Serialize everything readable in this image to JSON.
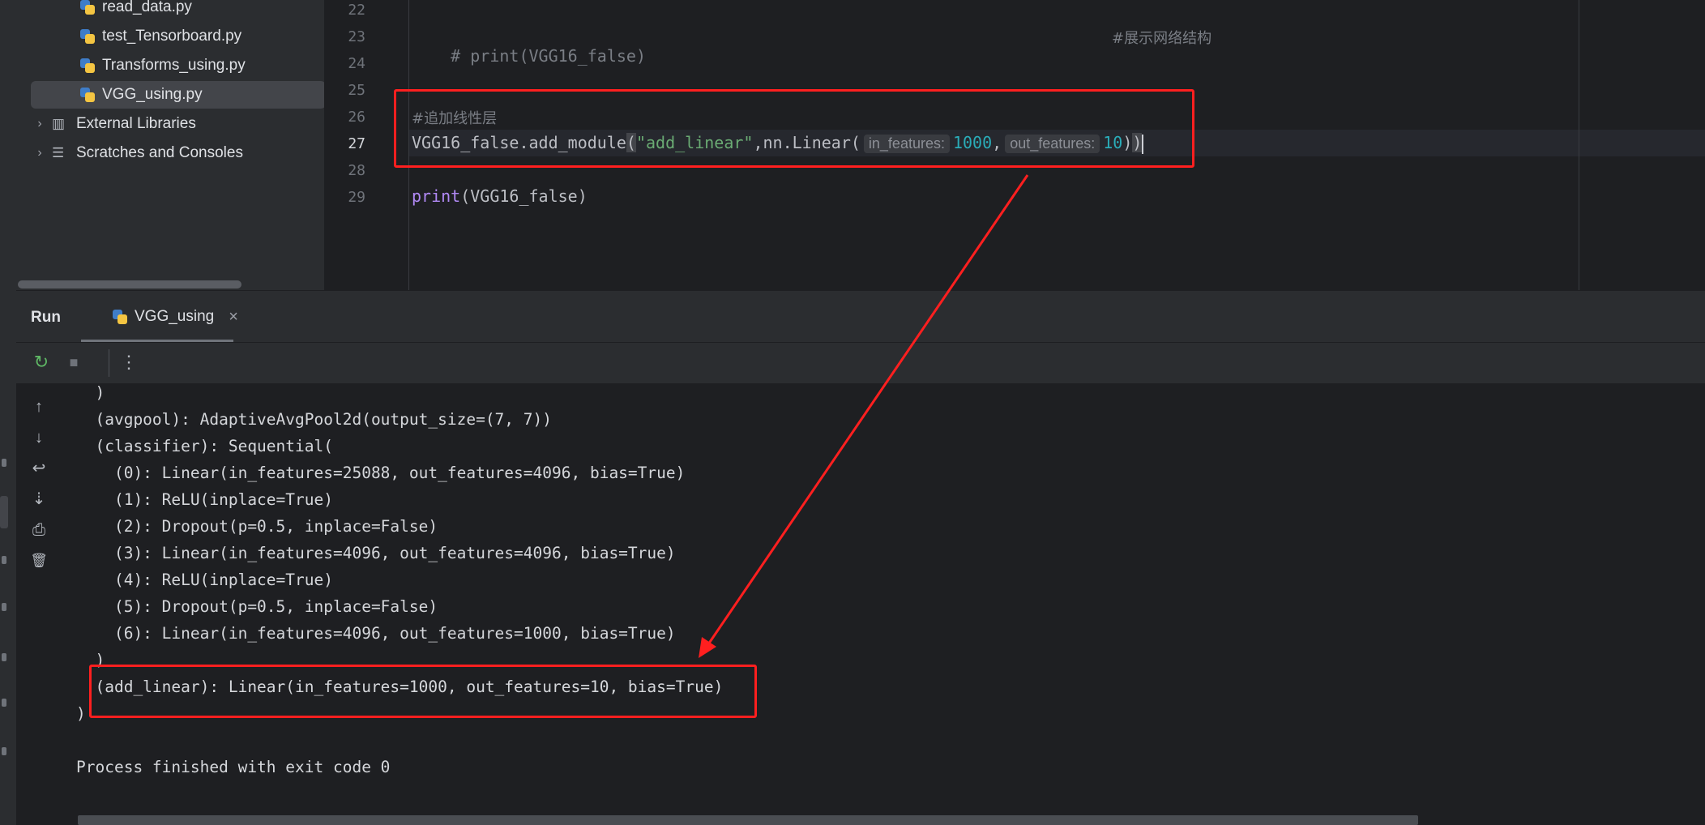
{
  "project_tree": {
    "items": [
      {
        "label": "read_data.py",
        "kind": "file",
        "selected": false
      },
      {
        "label": "test_Tensorboard.py",
        "kind": "file",
        "selected": false
      },
      {
        "label": "Transforms_using.py",
        "kind": "file",
        "selected": false
      },
      {
        "label": "VGG_using.py",
        "kind": "file",
        "selected": true
      },
      {
        "label": "External Libraries",
        "kind": "folder"
      },
      {
        "label": "Scratches and Consoles",
        "kind": "folder"
      }
    ]
  },
  "editor": {
    "line_numbers": [
      "22",
      "23",
      "24",
      "25",
      "26",
      "27",
      "28",
      "29"
    ],
    "current_line": "27",
    "line23_comment": "# print(VGG16_false)",
    "line23_trailing_comment": "#展示网络结构",
    "line26_comment": "#追加线性层",
    "line27": {
      "prefix": "VGG16_false.add_module",
      "open_paren": "(",
      "string_arg": "\"add_linear\"",
      "middle": ",nn.Linear(",
      "hint_in": "in_features:",
      "in_value": "1000",
      "comma": ",",
      "hint_out": "out_features:",
      "out_value": "10",
      "close": ")",
      "close_hl": ")"
    },
    "line29": {
      "fn": "print",
      "args": "(VGG16_false)"
    }
  },
  "run_panel": {
    "title": "Run",
    "tab_label": "VGG_using",
    "close_glyph": "×"
  },
  "console": {
    "lines": [
      "  )",
      "  (avgpool): AdaptiveAvgPool2d(output_size=(7, 7))",
      "  (classifier): Sequential(",
      "    (0): Linear(in_features=25088, out_features=4096, bias=True)",
      "    (1): ReLU(inplace=True)",
      "    (2): Dropout(p=0.5, inplace=False)",
      "    (3): Linear(in_features=4096, out_features=4096, bias=True)",
      "    (4): ReLU(inplace=True)",
      "    (5): Dropout(p=0.5, inplace=False)",
      "    (6): Linear(in_features=4096, out_features=1000, bias=True)",
      "  )",
      "  (add_linear): Linear(in_features=1000, out_features=10, bias=True)",
      ")",
      "",
      "Process finished with exit code 0"
    ]
  },
  "icons": {
    "tree_file": "python-file-icon",
    "tree_chevron": "›",
    "toolbar_rerun": "↻",
    "toolbar_stop": "■",
    "toolbar_more": "⋮",
    "side_up": "↑",
    "side_down": "↓",
    "side_wrap": "↩",
    "side_scroll_end": "⇣",
    "side_print": "⎙",
    "side_trash": "🗑"
  },
  "colors": {
    "annotation": "#ff1f1f",
    "string": "#6aab73",
    "number": "#2aacb8",
    "keyword": "#b189f5",
    "comment": "#7a7e85"
  }
}
